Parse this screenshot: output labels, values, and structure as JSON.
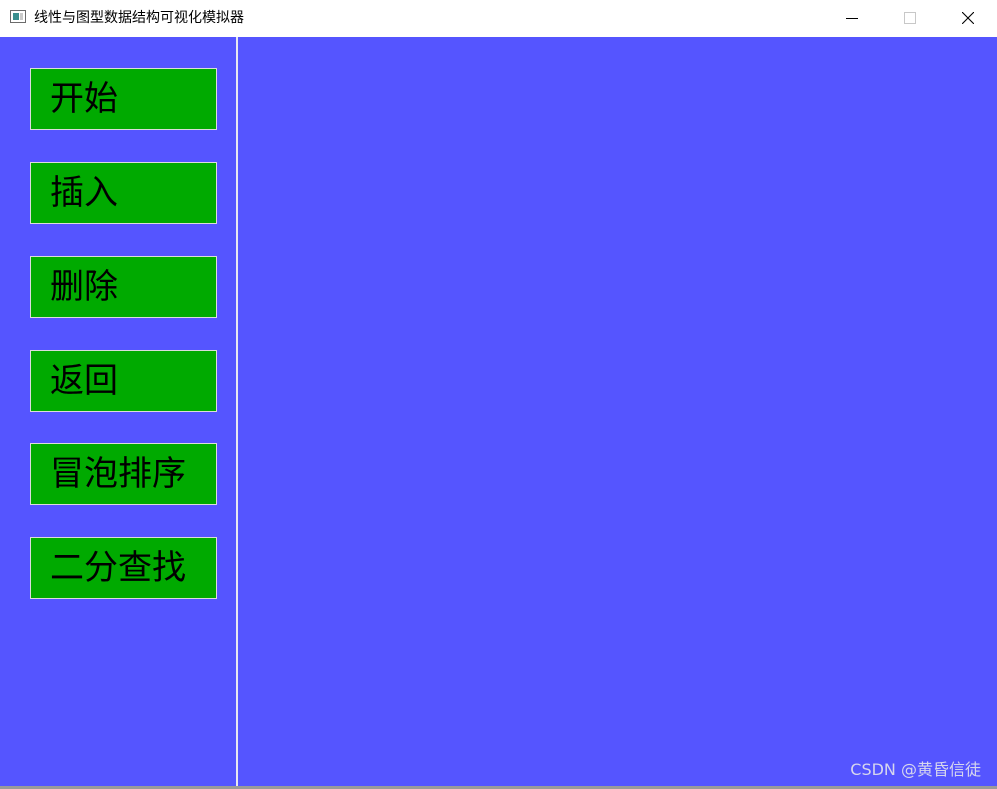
{
  "window": {
    "title": "线性与图型数据结构可视化模拟器",
    "icon": "app-window-icon",
    "controls": {
      "minimize": "minimize-icon",
      "maximize": "maximize-icon",
      "close": "close-icon"
    }
  },
  "colors": {
    "canvas_background": "#5555ff",
    "button_background": "#00aa00",
    "button_text": "#000000"
  },
  "sidebar": {
    "buttons": [
      {
        "label": "开始"
      },
      {
        "label": "插入"
      },
      {
        "label": "删除"
      },
      {
        "label": "返回"
      },
      {
        "label": "冒泡排序"
      },
      {
        "label": "二分查找"
      }
    ]
  },
  "watermark": "CSDN @黄昏信徒"
}
